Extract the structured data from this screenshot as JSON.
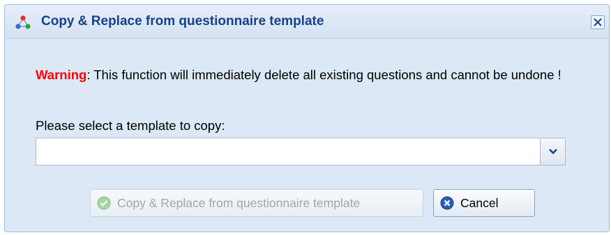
{
  "dialog": {
    "title": "Copy & Replace from questionnaire template",
    "close_label": "×"
  },
  "body": {
    "warning_label": "Warning",
    "warning_message": ": This function will immediately delete all existing questions and cannot be undone !",
    "select_label": "Please select a template to copy:"
  },
  "template_select": {
    "value": "",
    "placeholder": ""
  },
  "buttons": {
    "copy_replace": "Copy & Replace from questionnaire template",
    "cancel": "Cancel"
  },
  "icons": {
    "app": "network-nodes-icon",
    "close": "close-icon",
    "dropdown": "chevron-down-icon",
    "copy": "check-circle-icon",
    "cancel": "x-circle-icon"
  },
  "colors": {
    "title": "#15428b",
    "warning": "#ff0000",
    "dialog_bg": "#dce8f6",
    "disabled_text": "#a0a6ae"
  }
}
